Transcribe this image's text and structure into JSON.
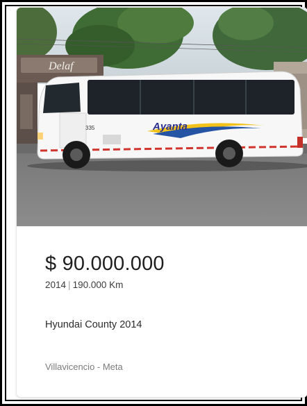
{
  "listing": {
    "price": "$ 90.000.000",
    "year": "2014",
    "separator": "|",
    "mileage": "190.000 Km",
    "title": "Hyundai County 2014",
    "location": "Villavicencio - Meta"
  },
  "photo": {
    "storefront_sign": "Delaf"
  },
  "colors": {
    "border": "#000000",
    "price_text": "#1f1f1f",
    "muted_text": "#7a7a7a"
  }
}
